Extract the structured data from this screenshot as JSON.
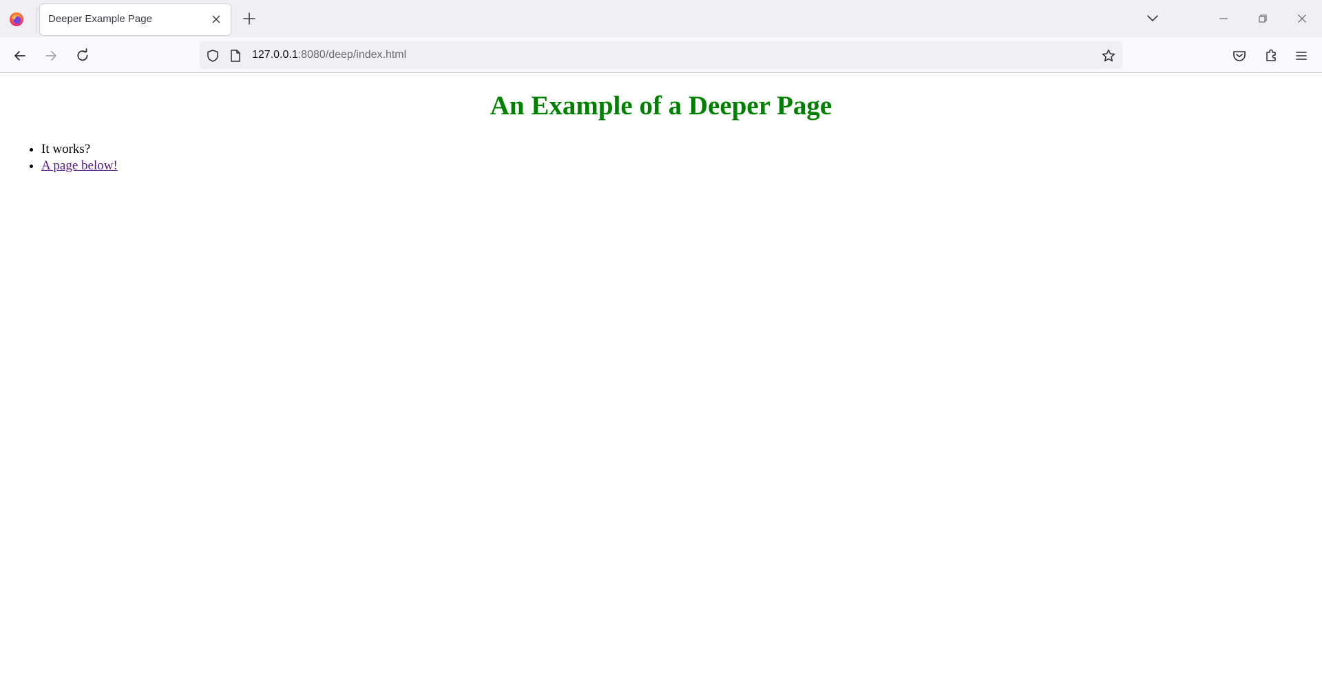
{
  "browser": {
    "tab": {
      "title": "Deeper Example Page"
    },
    "url": {
      "host": "127.0.0.1",
      "rest": ":8080/deep/index.html"
    },
    "icons": {
      "app": "firefox-icon",
      "tab_close": "close-icon",
      "new_tab": "plus-icon",
      "tab_list": "chevron-down-icon",
      "minimize": "minimize-icon",
      "restore": "restore-icon",
      "close_window": "close-icon",
      "back": "back-arrow-icon",
      "forward": "forward-arrow-icon",
      "reload": "reload-icon",
      "tracking_protection": "shield-icon",
      "page_info": "page-icon",
      "bookmark": "star-icon",
      "pocket": "pocket-icon",
      "extensions": "puzzle-icon",
      "app_menu": "hamburger-icon"
    }
  },
  "page": {
    "heading": "An Example of a Deeper Page",
    "heading_color": "#008000",
    "items": [
      {
        "text": "It works?"
      },
      {
        "text": "A page below!",
        "is_link": true
      }
    ],
    "link_color": "#551a8b"
  }
}
